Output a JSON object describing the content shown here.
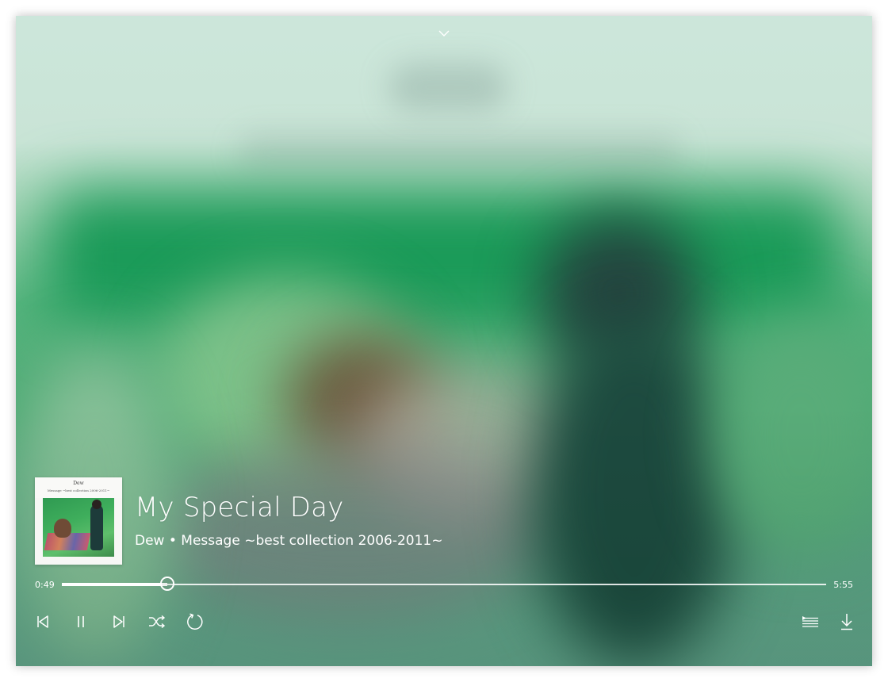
{
  "player": {
    "title": "My Special Day",
    "subtitle": "Dew • Message ~best collection 2006-2011~",
    "album_art": {
      "artist_text": "Dew",
      "album_text": "Message ~best collection 2006-2011~"
    },
    "progress": {
      "elapsed": "0:49",
      "total": "5:55",
      "fraction": 0.138
    }
  },
  "icons": {
    "collapse": "chevron-down-icon",
    "previous": "previous-track-icon",
    "pause": "pause-icon",
    "next": "next-track-icon",
    "shuffle": "shuffle-icon",
    "repeat": "repeat-icon",
    "queue": "queue-list-icon",
    "download": "download-icon"
  },
  "colors": {
    "foreground": "#ffffff",
    "backdrop_top": "#cde7dc",
    "backdrop_green": "#4aa872"
  }
}
